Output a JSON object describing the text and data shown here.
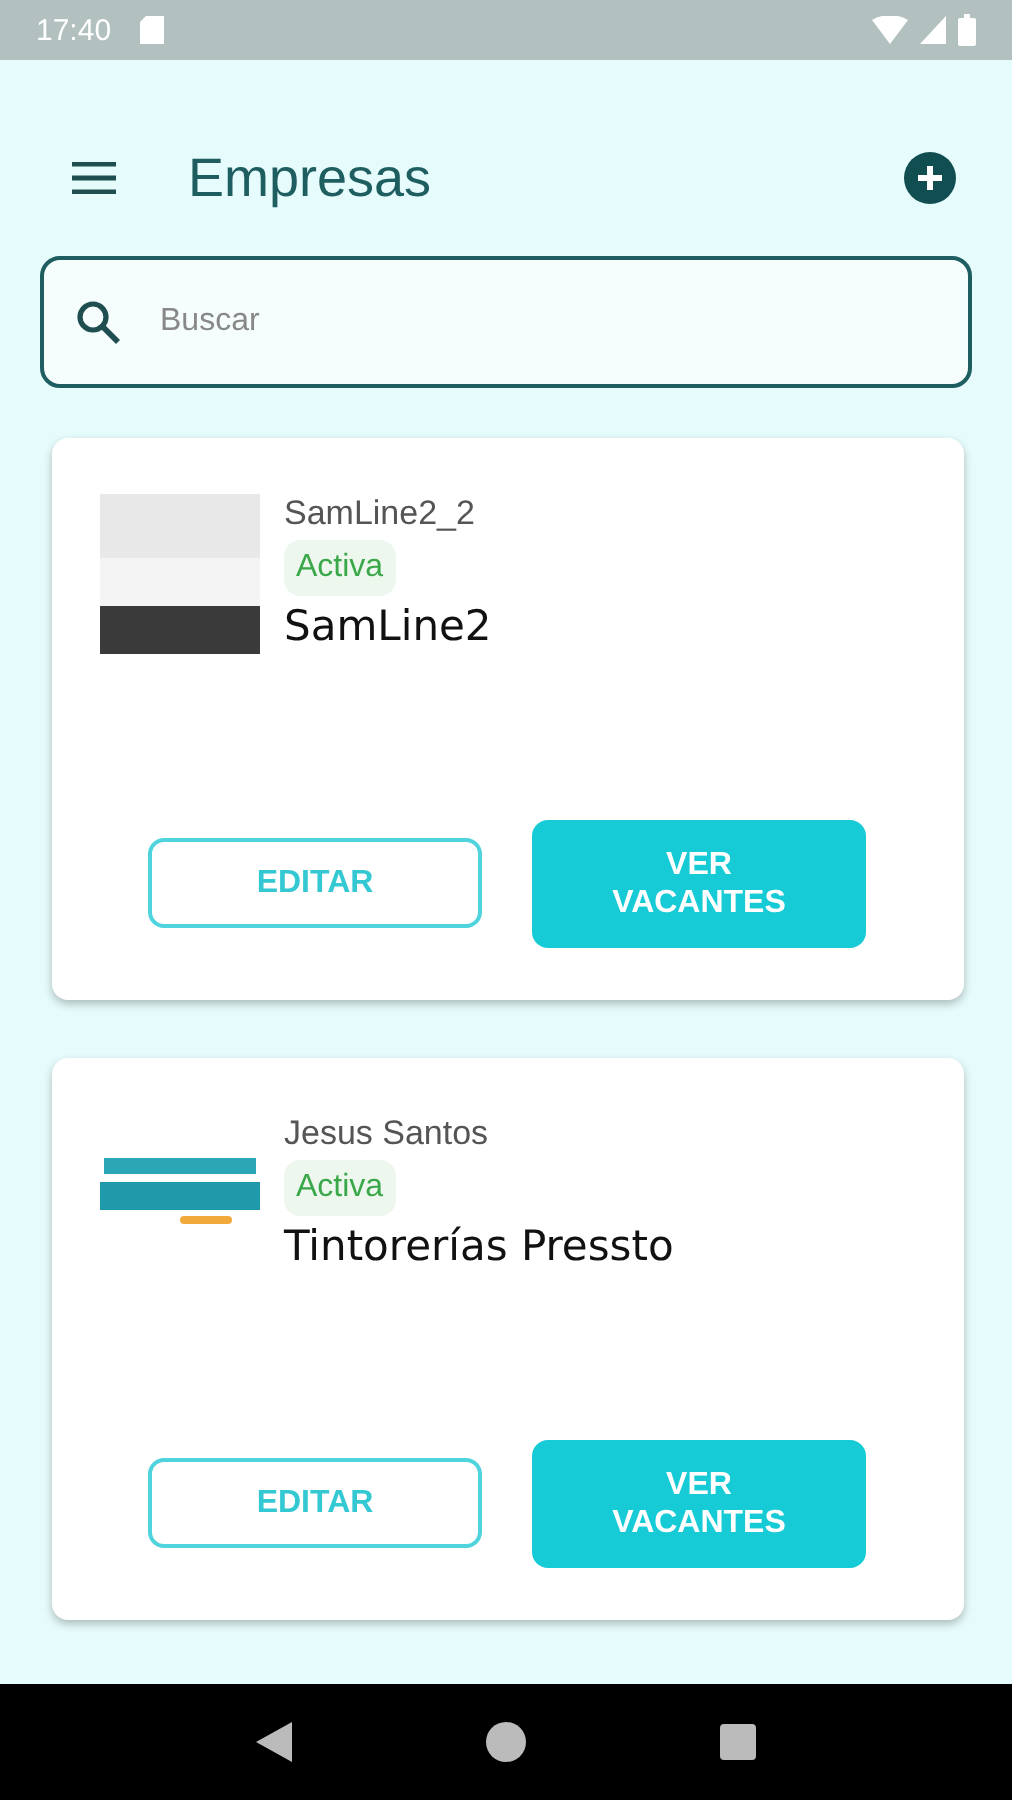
{
  "status_bar": {
    "time": "17:40"
  },
  "app_bar": {
    "title": "Empresas"
  },
  "search": {
    "placeholder": "Buscar"
  },
  "companies": [
    {
      "kind": "photo",
      "owner": "SamLine2_2",
      "status": "Activa",
      "name": "SamLine2",
      "buttons": [
        "EDITAR",
        "VER VACANTES"
      ]
    },
    {
      "kind": "logo",
      "owner": "Jesus Santos",
      "status": "Activa",
      "name": "Tintorerías Pressto",
      "buttons": [
        "EDITAR",
        "VER VACANTES"
      ]
    }
  ]
}
